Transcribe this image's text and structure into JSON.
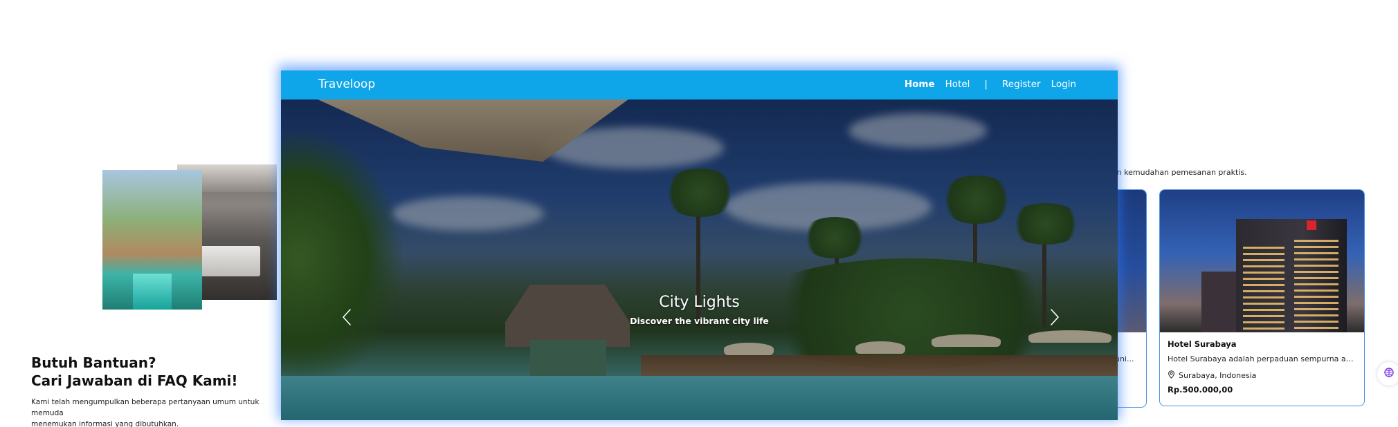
{
  "background": {
    "faq": {
      "title_line1": "Butuh Bantuan?",
      "title_line2": "Cari Jawaban di FAQ Kami!",
      "description_line1": "Kami telah mengumpulkan beberapa pertanyaan umum untuk memuda",
      "description_line2": "menemukan informasi yang dibutuhkan."
    },
    "promo_text": "dan kemudahan pemesanan praktis.",
    "partial_card_text": "duni...",
    "hotel_card": {
      "name": "Hotel Surabaya",
      "description": "Hotel Surabaya adalah perpaduan sempurna antara ...",
      "location": "Surabaya, Indonesia",
      "price": "Rp.500.000,00",
      "location_icon": "map-pin-icon"
    },
    "float_button_icon": "network-icon"
  },
  "navbar": {
    "brand": "Traveloop",
    "links": {
      "home": "Home",
      "hotel": "Hotel",
      "separator": "|",
      "register": "Register",
      "login": "Login"
    },
    "active": "Home",
    "background_color": "#0ea5e9"
  },
  "carousel": {
    "title": "City Lights",
    "subtitle": "Discover the vibrant city life",
    "prev_icon": "chevron-left-icon",
    "next_icon": "chevron-right-icon"
  },
  "colors": {
    "accent": "#0ea5e9",
    "card_border": "#4a90e2",
    "modal_glow": "#2878ff"
  }
}
